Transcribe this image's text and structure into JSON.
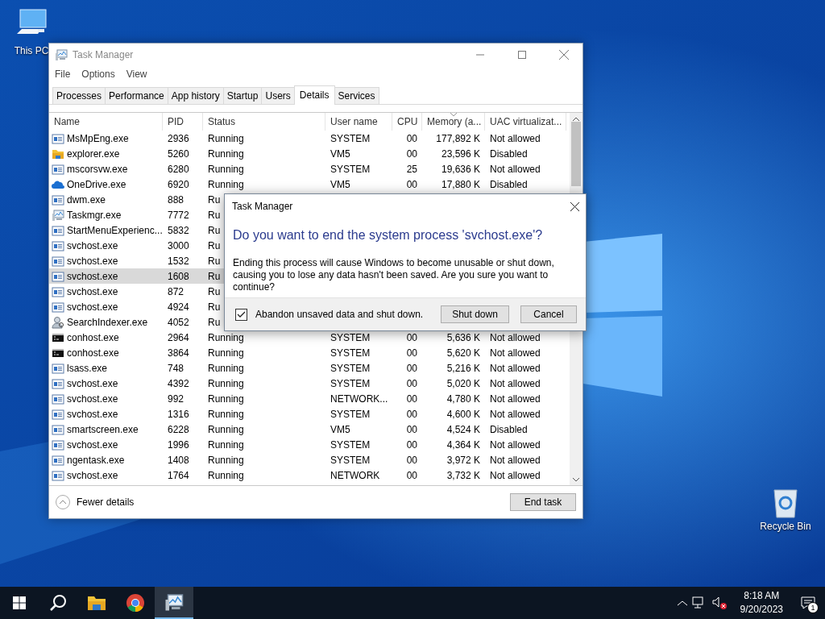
{
  "desktop_icons": [
    {
      "label": "This PC",
      "kind": "computer"
    },
    {
      "label": "Recycle Bin",
      "kind": "bin"
    }
  ],
  "window": {
    "title": "Task Manager",
    "menu": [
      "File",
      "Options",
      "View"
    ],
    "tabs": [
      {
        "label": "Processes",
        "selected": false
      },
      {
        "label": "Performance",
        "selected": false
      },
      {
        "label": "App history",
        "selected": false
      },
      {
        "label": "Startup",
        "selected": false
      },
      {
        "label": "Users",
        "selected": false
      },
      {
        "label": "Details",
        "selected": true
      },
      {
        "label": "Services",
        "selected": false
      }
    ],
    "table": {
      "columns": [
        "Name",
        "PID",
        "Status",
        "User name",
        "CPU",
        "Memory (a...",
        "UAC virtualizat..."
      ],
      "rows": [
        {
          "kind": "service",
          "name": "MsMpEng.exe",
          "pid": "2936",
          "status": "Running",
          "user": "SYSTEM",
          "cpu": "00",
          "memory": "177,892 K",
          "uac": "Not allowed",
          "selected": false
        },
        {
          "kind": "folder",
          "name": "explorer.exe",
          "pid": "5260",
          "status": "Running",
          "user": "VM5",
          "cpu": "00",
          "memory": "23,596 K",
          "uac": "Disabled",
          "selected": false
        },
        {
          "kind": "service",
          "name": "mscorsvw.exe",
          "pid": "6280",
          "status": "Running",
          "user": "SYSTEM",
          "cpu": "25",
          "memory": "19,636 K",
          "uac": "Not allowed",
          "selected": false
        },
        {
          "kind": "cloud",
          "name": "OneDrive.exe",
          "pid": "6920",
          "status": "Running",
          "user": "VM5",
          "cpu": "00",
          "memory": "17,880 K",
          "uac": "Disabled",
          "selected": false
        },
        {
          "kind": "service",
          "name": "dwm.exe",
          "pid": "888",
          "status": "Ru",
          "selected": false
        },
        {
          "kind": "monitor",
          "name": "Taskmgr.exe",
          "pid": "7772",
          "status": "Ru",
          "selected": false
        },
        {
          "kind": "service",
          "name": "StartMenuExperienc...",
          "pid": "5832",
          "status": "Ru",
          "selected": false
        },
        {
          "kind": "service",
          "name": "svchost.exe",
          "pid": "3000",
          "status": "Ru",
          "selected": false
        },
        {
          "kind": "service",
          "name": "svchost.exe",
          "pid": "1532",
          "status": "Ru",
          "selected": false
        },
        {
          "kind": "service",
          "name": "svchost.exe",
          "pid": "1608",
          "status": "Ru",
          "selected": true
        },
        {
          "kind": "service",
          "name": "svchost.exe",
          "pid": "872",
          "status": "Ru",
          "selected": false
        },
        {
          "kind": "service",
          "name": "svchost.exe",
          "pid": "4924",
          "status": "Ru",
          "selected": false
        },
        {
          "kind": "search",
          "name": "SearchIndexer.exe",
          "pid": "4052",
          "status": "Ru",
          "selected": false
        },
        {
          "kind": "console",
          "name": "conhost.exe",
          "pid": "2964",
          "status": "Running",
          "user": "SYSTEM",
          "cpu": "00",
          "memory": "5,636 K",
          "uac": "Not allowed",
          "selected": false
        },
        {
          "kind": "console",
          "name": "conhost.exe",
          "pid": "3864",
          "status": "Running",
          "user": "SYSTEM",
          "cpu": "00",
          "memory": "5,620 K",
          "uac": "Not allowed",
          "selected": false
        },
        {
          "kind": "service",
          "name": "lsass.exe",
          "pid": "748",
          "status": "Running",
          "user": "SYSTEM",
          "cpu": "00",
          "memory": "5,216 K",
          "uac": "Not allowed",
          "selected": false
        },
        {
          "kind": "service",
          "name": "svchost.exe",
          "pid": "4392",
          "status": "Running",
          "user": "SYSTEM",
          "cpu": "00",
          "memory": "5,020 K",
          "uac": "Not allowed",
          "selected": false
        },
        {
          "kind": "service",
          "name": "svchost.exe",
          "pid": "992",
          "status": "Running",
          "user": "NETWORK...",
          "cpu": "00",
          "memory": "4,780 K",
          "uac": "Not allowed",
          "selected": false
        },
        {
          "kind": "service",
          "name": "svchost.exe",
          "pid": "1316",
          "status": "Running",
          "user": "SYSTEM",
          "cpu": "00",
          "memory": "4,600 K",
          "uac": "Not allowed",
          "selected": false
        },
        {
          "kind": "service",
          "name": "smartscreen.exe",
          "pid": "6228",
          "status": "Running",
          "user": "VM5",
          "cpu": "00",
          "memory": "4,524 K",
          "uac": "Disabled",
          "selected": false
        },
        {
          "kind": "service",
          "name": "svchost.exe",
          "pid": "1996",
          "status": "Running",
          "user": "SYSTEM",
          "cpu": "00",
          "memory": "4,364 K",
          "uac": "Not allowed",
          "selected": false
        },
        {
          "kind": "service",
          "name": "ngentask.exe",
          "pid": "1408",
          "status": "Running",
          "user": "SYSTEM",
          "cpu": "00",
          "memory": "3,972 K",
          "uac": "Not allowed",
          "selected": false
        },
        {
          "kind": "service",
          "name": "svchost.exe",
          "pid": "1764",
          "status": "Running",
          "user": "NETWORK",
          "cpu": "00",
          "memory": "3,732 K",
          "uac": "Not allowed",
          "selected": false
        }
      ]
    },
    "fewer_details": "Fewer details",
    "end_task": "End task"
  },
  "dialog": {
    "title": "Task Manager",
    "heading": "Do you want to end the system process 'svchost.exe'?",
    "body": "Ending this process will cause Windows to become unusable or shut down, causing you to lose any data hasn't been saved. Are you sure you want to continue?",
    "checkbox": {
      "label": "Abandon unsaved data and shut down.",
      "checked": true
    },
    "buttons": [
      "Shut down",
      "Cancel"
    ]
  },
  "taskbar": {
    "apps": [
      {
        "kind": "search",
        "selected": false
      },
      {
        "kind": "folder",
        "selected": false
      },
      {
        "kind": "browser",
        "selected": false
      },
      {
        "kind": "monitor",
        "selected": true
      }
    ],
    "time": "8:18 AM",
    "date": "9/20/2023",
    "notifications": "1"
  }
}
